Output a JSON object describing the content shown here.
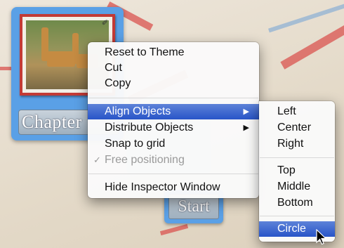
{
  "canvas": {
    "chapter_card_label": "Chapter",
    "start_card_label": "Start"
  },
  "context_menu": {
    "items": [
      {
        "label": "Reset to Theme"
      },
      {
        "label": "Cut"
      },
      {
        "label": "Copy"
      },
      {
        "label": "Align Objects",
        "submenu": true,
        "highlighted": true
      },
      {
        "label": "Distribute Objects",
        "submenu": true
      },
      {
        "label": "Snap to grid"
      },
      {
        "label": "Free positioning",
        "checked": true,
        "disabled": true
      },
      {
        "label": "Hide Inspector Window"
      }
    ],
    "arrow_glyph": "▶",
    "check_glyph": "✓"
  },
  "submenu": {
    "items": [
      {
        "label": "Left"
      },
      {
        "label": "Center"
      },
      {
        "label": "Right"
      },
      {
        "label": "Top"
      },
      {
        "label": "Middle"
      },
      {
        "label": "Bottom"
      },
      {
        "label": "Circle",
        "highlighted": true
      }
    ]
  },
  "colors": {
    "highlight": "#2855c8",
    "card_blue": "#5aa0e6",
    "photo_border": "#c33a36"
  },
  "icons": {
    "pushpin": "pushpin-icon",
    "cursor": "arrow-cursor-icon"
  }
}
